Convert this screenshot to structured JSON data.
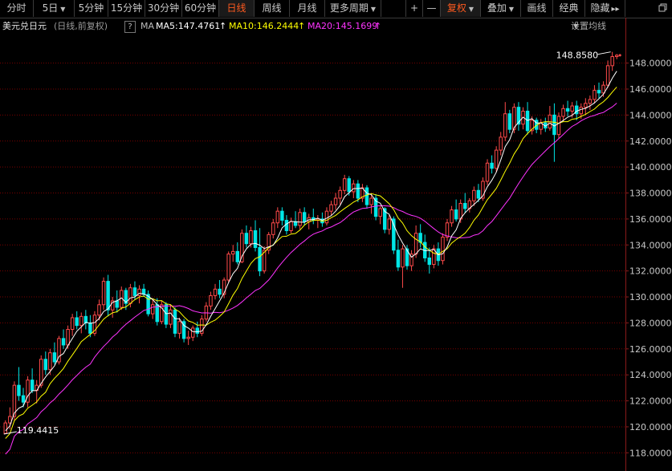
{
  "toolbar": {
    "items": [
      {
        "label": "分时",
        "dropdown": false
      },
      {
        "label": "5日",
        "dropdown": true
      },
      {
        "label": "5分钟",
        "dropdown": false
      },
      {
        "label": "15分钟",
        "dropdown": false
      },
      {
        "label": "30分钟",
        "dropdown": false
      },
      {
        "label": "60分钟",
        "dropdown": false
      },
      {
        "label": "日线",
        "dropdown": false,
        "active": true
      },
      {
        "label": "周线",
        "dropdown": false
      },
      {
        "label": "月线",
        "dropdown": false
      },
      {
        "label": "更多周期",
        "dropdown": true
      },
      {
        "label": "+",
        "dropdown": false
      },
      {
        "label": "—",
        "dropdown": false
      },
      {
        "label": "复权",
        "dropdown": true,
        "active": true
      },
      {
        "label": "叠加",
        "dropdown": true
      },
      {
        "label": "画线",
        "dropdown": false
      },
      {
        "label": "经典",
        "dropdown": false
      },
      {
        "label": "隐藏",
        "dropdown": false,
        "arrows": "▸▸"
      }
    ],
    "restore_icon": "restore-window-icon"
  },
  "info": {
    "title": "美元兑日元",
    "mode": "(日线,前复权)",
    "help": "?",
    "ma_label": "MA",
    "ma5": "MA5:147.4761",
    "ma10": "MA10:146.2444",
    "ma20": "MA20:145.1699",
    "settings": "设置均线"
  },
  "colors": {
    "up": "#ff4a4a",
    "down": "#00e6e6",
    "ma5": "#ffffff",
    "ma10": "#ffff00",
    "ma20": "#ff33ff",
    "grid": "#7a0000",
    "axis_text": "#c8c8c8",
    "active": "#ff5a1f"
  },
  "chart_data": {
    "type": "candlestick",
    "y_ticks": [
      "148.0000",
      "146.0000",
      "144.0000",
      "142.0000",
      "140.0000",
      "138.0000",
      "136.0000",
      "134.0000",
      "132.0000",
      "130.0000",
      "128.0000",
      "126.0000",
      "124.0000",
      "122.0000",
      "120.0000",
      "118.0000"
    ],
    "ylim": [
      116.6,
      150.2
    ],
    "annotations": {
      "high": "148.8580",
      "low": "119.4415"
    },
    "candles": [
      [
        119.5,
        120.5,
        119.44,
        120.3
      ],
      [
        120.3,
        121.5,
        119.8,
        120.8
      ],
      [
        120.8,
        123.5,
        120.5,
        123.2
      ],
      [
        123.2,
        124.6,
        122.0,
        122.4
      ],
      [
        122.4,
        123.0,
        121.5,
        121.9
      ],
      [
        121.9,
        123.9,
        121.5,
        123.6
      ],
      [
        123.6,
        124.5,
        122.6,
        122.8
      ],
      [
        122.8,
        123.6,
        121.8,
        123.2
      ],
      [
        123.2,
        125.5,
        123.0,
        125.2
      ],
      [
        125.2,
        125.8,
        124.0,
        124.4
      ],
      [
        124.4,
        126.0,
        124.0,
        125.7
      ],
      [
        125.7,
        126.5,
        124.8,
        125.0
      ],
      [
        125.0,
        127.0,
        124.8,
        126.8
      ],
      [
        126.8,
        127.5,
        126.0,
        126.3
      ],
      [
        126.3,
        127.8,
        126.0,
        127.5
      ],
      [
        127.5,
        128.7,
        127.0,
        128.4
      ],
      [
        128.4,
        128.9,
        127.5,
        127.8
      ],
      [
        127.8,
        128.8,
        127.2,
        128.5
      ],
      [
        128.5,
        129.0,
        127.5,
        128.0
      ],
      [
        128.0,
        128.6,
        126.9,
        127.2
      ],
      [
        127.2,
        128.9,
        127.0,
        128.6
      ],
      [
        128.6,
        129.8,
        128.2,
        129.4
      ],
      [
        129.4,
        131.5,
        129.0,
        131.2
      ],
      [
        131.2,
        131.7,
        128.5,
        129.0
      ],
      [
        129.0,
        130.0,
        128.4,
        129.7
      ],
      [
        129.7,
        130.5,
        128.8,
        129.2
      ],
      [
        129.2,
        130.8,
        129.0,
        130.5
      ],
      [
        130.5,
        130.7,
        129.0,
        129.5
      ],
      [
        129.5,
        131.0,
        129.2,
        130.7
      ],
      [
        130.7,
        131.2,
        129.8,
        130.1
      ],
      [
        130.1,
        130.9,
        129.5,
        130.6
      ],
      [
        130.6,
        131.0,
        130.0,
        130.2
      ],
      [
        130.2,
        130.5,
        128.5,
        128.7
      ],
      [
        128.7,
        129.8,
        128.3,
        129.4
      ],
      [
        129.4,
        129.9,
        127.8,
        128.1
      ],
      [
        128.1,
        129.7,
        127.9,
        129.4
      ],
      [
        129.4,
        129.6,
        127.6,
        127.9
      ],
      [
        127.9,
        129.4,
        127.6,
        129.0
      ],
      [
        129.0,
        129.2,
        126.9,
        127.2
      ],
      [
        127.2,
        128.4,
        126.8,
        128.1
      ],
      [
        128.1,
        128.3,
        126.5,
        126.8
      ],
      [
        126.8,
        127.4,
        126.3,
        126.9
      ],
      [
        126.9,
        127.8,
        126.6,
        127.6
      ],
      [
        127.6,
        128.1,
        126.9,
        127.2
      ],
      [
        127.2,
        128.6,
        127.0,
        128.3
      ],
      [
        128.3,
        129.6,
        128.1,
        129.3
      ],
      [
        129.3,
        130.4,
        129.0,
        130.1
      ],
      [
        130.1,
        131.0,
        129.8,
        130.6
      ],
      [
        130.6,
        131.3,
        129.9,
        130.2
      ],
      [
        130.2,
        131.5,
        129.9,
        131.3
      ],
      [
        131.3,
        133.5,
        131.1,
        133.3
      ],
      [
        133.3,
        134.0,
        132.7,
        133.5
      ],
      [
        133.5,
        134.2,
        132.5,
        132.7
      ],
      [
        132.7,
        135.2,
        132.6,
        134.9
      ],
      [
        134.9,
        135.5,
        133.8,
        134.1
      ],
      [
        134.1,
        135.4,
        133.8,
        135.1
      ],
      [
        135.1,
        135.9,
        133.5,
        133.8
      ],
      [
        133.8,
        135.3,
        131.6,
        132.0
      ],
      [
        132.0,
        133.9,
        131.8,
        133.6
      ],
      [
        133.6,
        135.0,
        133.3,
        134.8
      ],
      [
        134.8,
        136.0,
        134.5,
        135.7
      ],
      [
        135.7,
        136.9,
        135.3,
        136.6
      ],
      [
        136.6,
        136.9,
        135.5,
        135.9
      ],
      [
        135.9,
        136.3,
        134.8,
        135.1
      ],
      [
        135.1,
        136.1,
        134.9,
        135.8
      ],
      [
        135.8,
        136.6,
        135.3,
        135.5
      ],
      [
        135.5,
        136.8,
        135.2,
        136.5
      ],
      [
        136.5,
        136.9,
        135.5,
        135.8
      ],
      [
        135.8,
        136.4,
        135.2,
        136.1
      ],
      [
        136.1,
        136.8,
        135.6,
        135.9
      ],
      [
        135.9,
        136.3,
        135.3,
        136.0
      ],
      [
        136.0,
        136.5,
        135.4,
        135.7
      ],
      [
        135.7,
        136.9,
        135.5,
        136.6
      ],
      [
        136.6,
        137.4,
        136.3,
        137.1
      ],
      [
        137.1,
        138.0,
        136.7,
        137.6
      ],
      [
        137.6,
        138.5,
        137.1,
        138.2
      ],
      [
        138.2,
        139.4,
        137.9,
        139.1
      ],
      [
        139.1,
        139.3,
        137.8,
        138.1
      ],
      [
        138.1,
        139.0,
        137.6,
        138.7
      ],
      [
        138.7,
        139.0,
        137.3,
        137.6
      ],
      [
        137.6,
        138.7,
        137.3,
        138.4
      ],
      [
        138.4,
        138.6,
        136.8,
        137.1
      ],
      [
        137.1,
        137.9,
        136.4,
        137.6
      ],
      [
        137.6,
        137.9,
        135.9,
        136.2
      ],
      [
        136.2,
        137.0,
        135.6,
        136.8
      ],
      [
        136.8,
        136.9,
        134.9,
        135.2
      ],
      [
        135.2,
        136.3,
        134.8,
        136.0
      ],
      [
        136.0,
        136.2,
        133.3,
        133.6
      ],
      [
        133.6,
        134.4,
        132.0,
        132.3
      ],
      [
        132.3,
        134.0,
        130.7,
        133.7
      ],
      [
        133.7,
        134.0,
        132.1,
        132.4
      ],
      [
        132.4,
        133.6,
        132.0,
        133.3
      ],
      [
        133.3,
        135.5,
        133.0,
        134.9
      ],
      [
        134.9,
        135.6,
        133.8,
        134.2
      ],
      [
        134.2,
        134.8,
        132.7,
        133.0
      ],
      [
        133.0,
        133.8,
        131.8,
        132.5
      ],
      [
        132.5,
        134.0,
        132.2,
        133.7
      ],
      [
        133.7,
        134.2,
        132.4,
        132.8
      ],
      [
        132.8,
        134.9,
        132.5,
        134.6
      ],
      [
        134.6,
        136.0,
        134.3,
        135.7
      ],
      [
        135.7,
        137.0,
        135.4,
        136.7
      ],
      [
        136.7,
        137.5,
        135.8,
        136.0
      ],
      [
        136.0,
        137.5,
        135.7,
        137.2
      ],
      [
        137.2,
        138.0,
        136.5,
        136.8
      ],
      [
        136.8,
        137.6,
        136.5,
        137.4
      ],
      [
        137.4,
        138.5,
        137.0,
        138.2
      ],
      [
        138.2,
        138.7,
        137.3,
        137.6
      ],
      [
        137.6,
        139.2,
        137.4,
        138.9
      ],
      [
        138.9,
        140.6,
        138.6,
        140.3
      ],
      [
        140.3,
        140.9,
        139.5,
        139.9
      ],
      [
        139.9,
        141.6,
        139.6,
        141.3
      ],
      [
        141.3,
        142.7,
        140.9,
        142.3
      ],
      [
        142.3,
        145.0,
        142.0,
        144.1
      ],
      [
        144.1,
        144.4,
        142.6,
        142.9
      ],
      [
        142.9,
        144.9,
        142.6,
        144.6
      ],
      [
        144.6,
        145.0,
        142.8,
        143.3
      ],
      [
        143.3,
        144.6,
        142.9,
        144.3
      ],
      [
        144.3,
        145.0,
        142.5,
        142.8
      ],
      [
        142.8,
        143.9,
        142.5,
        143.6
      ],
      [
        143.6,
        143.8,
        142.6,
        142.9
      ],
      [
        142.9,
        143.7,
        142.5,
        143.4
      ],
      [
        143.4,
        143.8,
        142.7,
        143.0
      ],
      [
        143.0,
        144.7,
        142.8,
        144.0
      ],
      [
        144.0,
        144.9,
        140.4,
        142.5
      ],
      [
        142.5,
        144.2,
        142.2,
        143.9
      ],
      [
        143.9,
        144.8,
        143.5,
        144.5
      ],
      [
        144.5,
        145.1,
        143.9,
        144.3
      ],
      [
        144.3,
        145.0,
        143.8,
        144.7
      ],
      [
        144.7,
        145.1,
        143.6,
        144.1
      ],
      [
        144.1,
        144.9,
        143.7,
        144.6
      ],
      [
        144.6,
        145.3,
        144.0,
        144.9
      ],
      [
        144.9,
        145.5,
        144.4,
        145.2
      ],
      [
        145.2,
        146.3,
        144.9,
        145.9
      ],
      [
        145.9,
        146.5,
        145.3,
        145.7
      ],
      [
        145.7,
        146.6,
        145.4,
        146.3
      ],
      [
        146.3,
        148.2,
        146.1,
        147.8
      ],
      [
        147.8,
        148.86,
        147.4,
        148.5
      ],
      [
        148.5,
        148.7,
        148.3,
        148.6
      ]
    ]
  }
}
